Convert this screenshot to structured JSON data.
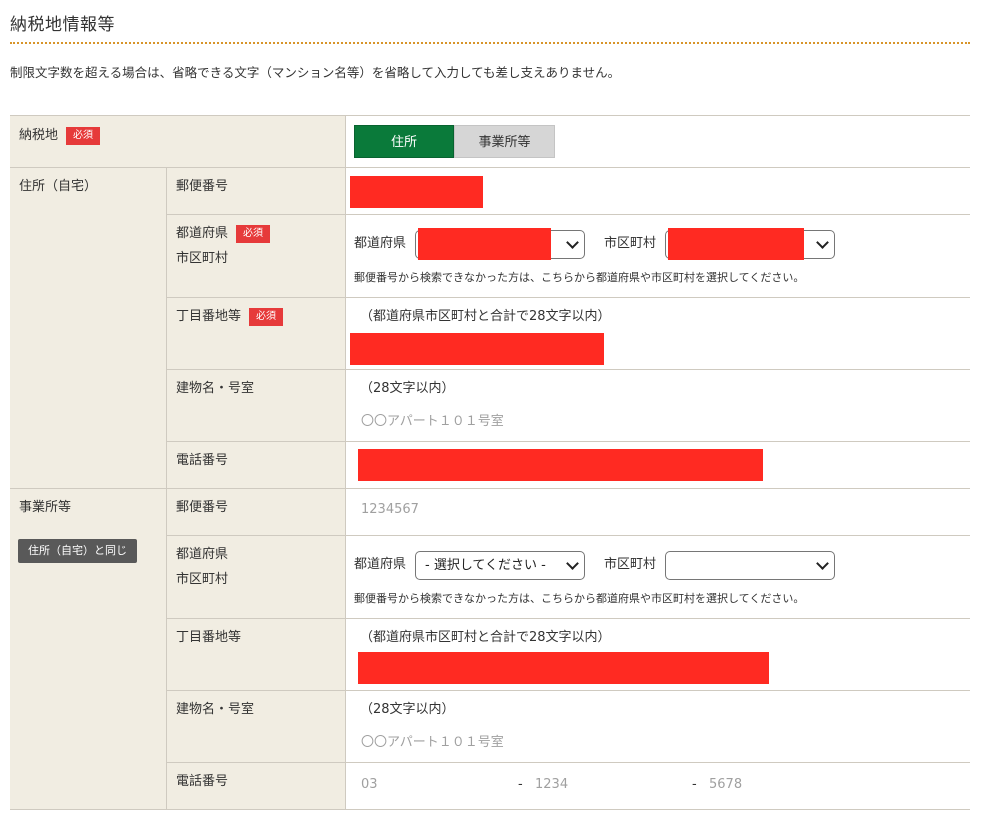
{
  "section_title": "納税地情報等",
  "note": "制限文字数を超える場合は、省略できる文字（マンション名等）を省略して入力しても差し支えありません。",
  "required_badge": "必須",
  "tax_place": {
    "label": "納税地",
    "options": [
      "住所",
      "事業所等"
    ],
    "selected": "住所"
  },
  "home": {
    "group_label": "住所（自宅）",
    "postal_label": "郵便番号",
    "pref_city_label_1": "都道府県",
    "pref_city_label_2": "市区町村",
    "pref_inline": "都道府県",
    "city_inline": "市区町村",
    "helper": "郵便番号から検索できなかった方は、こちらから都道府県や市区町村を選択してください。",
    "street_label": "丁目番地等",
    "street_hint": "（都道府県市区町村と合計で28文字以内）",
    "building_label": "建物名・号室",
    "building_hint": "（28文字以内）",
    "building_placeholder": "〇〇アパート１０１号室",
    "phone_label": "電話番号"
  },
  "office": {
    "group_label": "事業所等",
    "copy_button": "住所（自宅）と同じ",
    "postal_label": "郵便番号",
    "postal_placeholder": "1234567",
    "pref_city_label_1": "都道府県",
    "pref_city_label_2": "市区町村",
    "pref_inline": "都道府県",
    "pref_select": "- 選択してください -",
    "city_inline": "市区町村",
    "city_select": "",
    "helper": "郵便番号から検索できなかった方は、こちらから都道府県や市区町村を選択してください。",
    "street_label": "丁目番地等",
    "street_hint": "（都道府県市区町村と合計で28文字以内）",
    "building_label": "建物名・号室",
    "building_hint": "（28文字以内）",
    "building_placeholder": "〇〇アパート１０１号室",
    "phone_label": "電話番号",
    "phone_1_placeholder": "03",
    "phone_2_placeholder": "1234",
    "phone_3_placeholder": "5678",
    "dash": "-"
  },
  "colors": {
    "accent_green": "#0a7a3a",
    "required_red": "#e63a3a",
    "redaction_red": "#ff2a22",
    "label_bg": "#f1ede2",
    "rule_orange": "#d8952a"
  }
}
